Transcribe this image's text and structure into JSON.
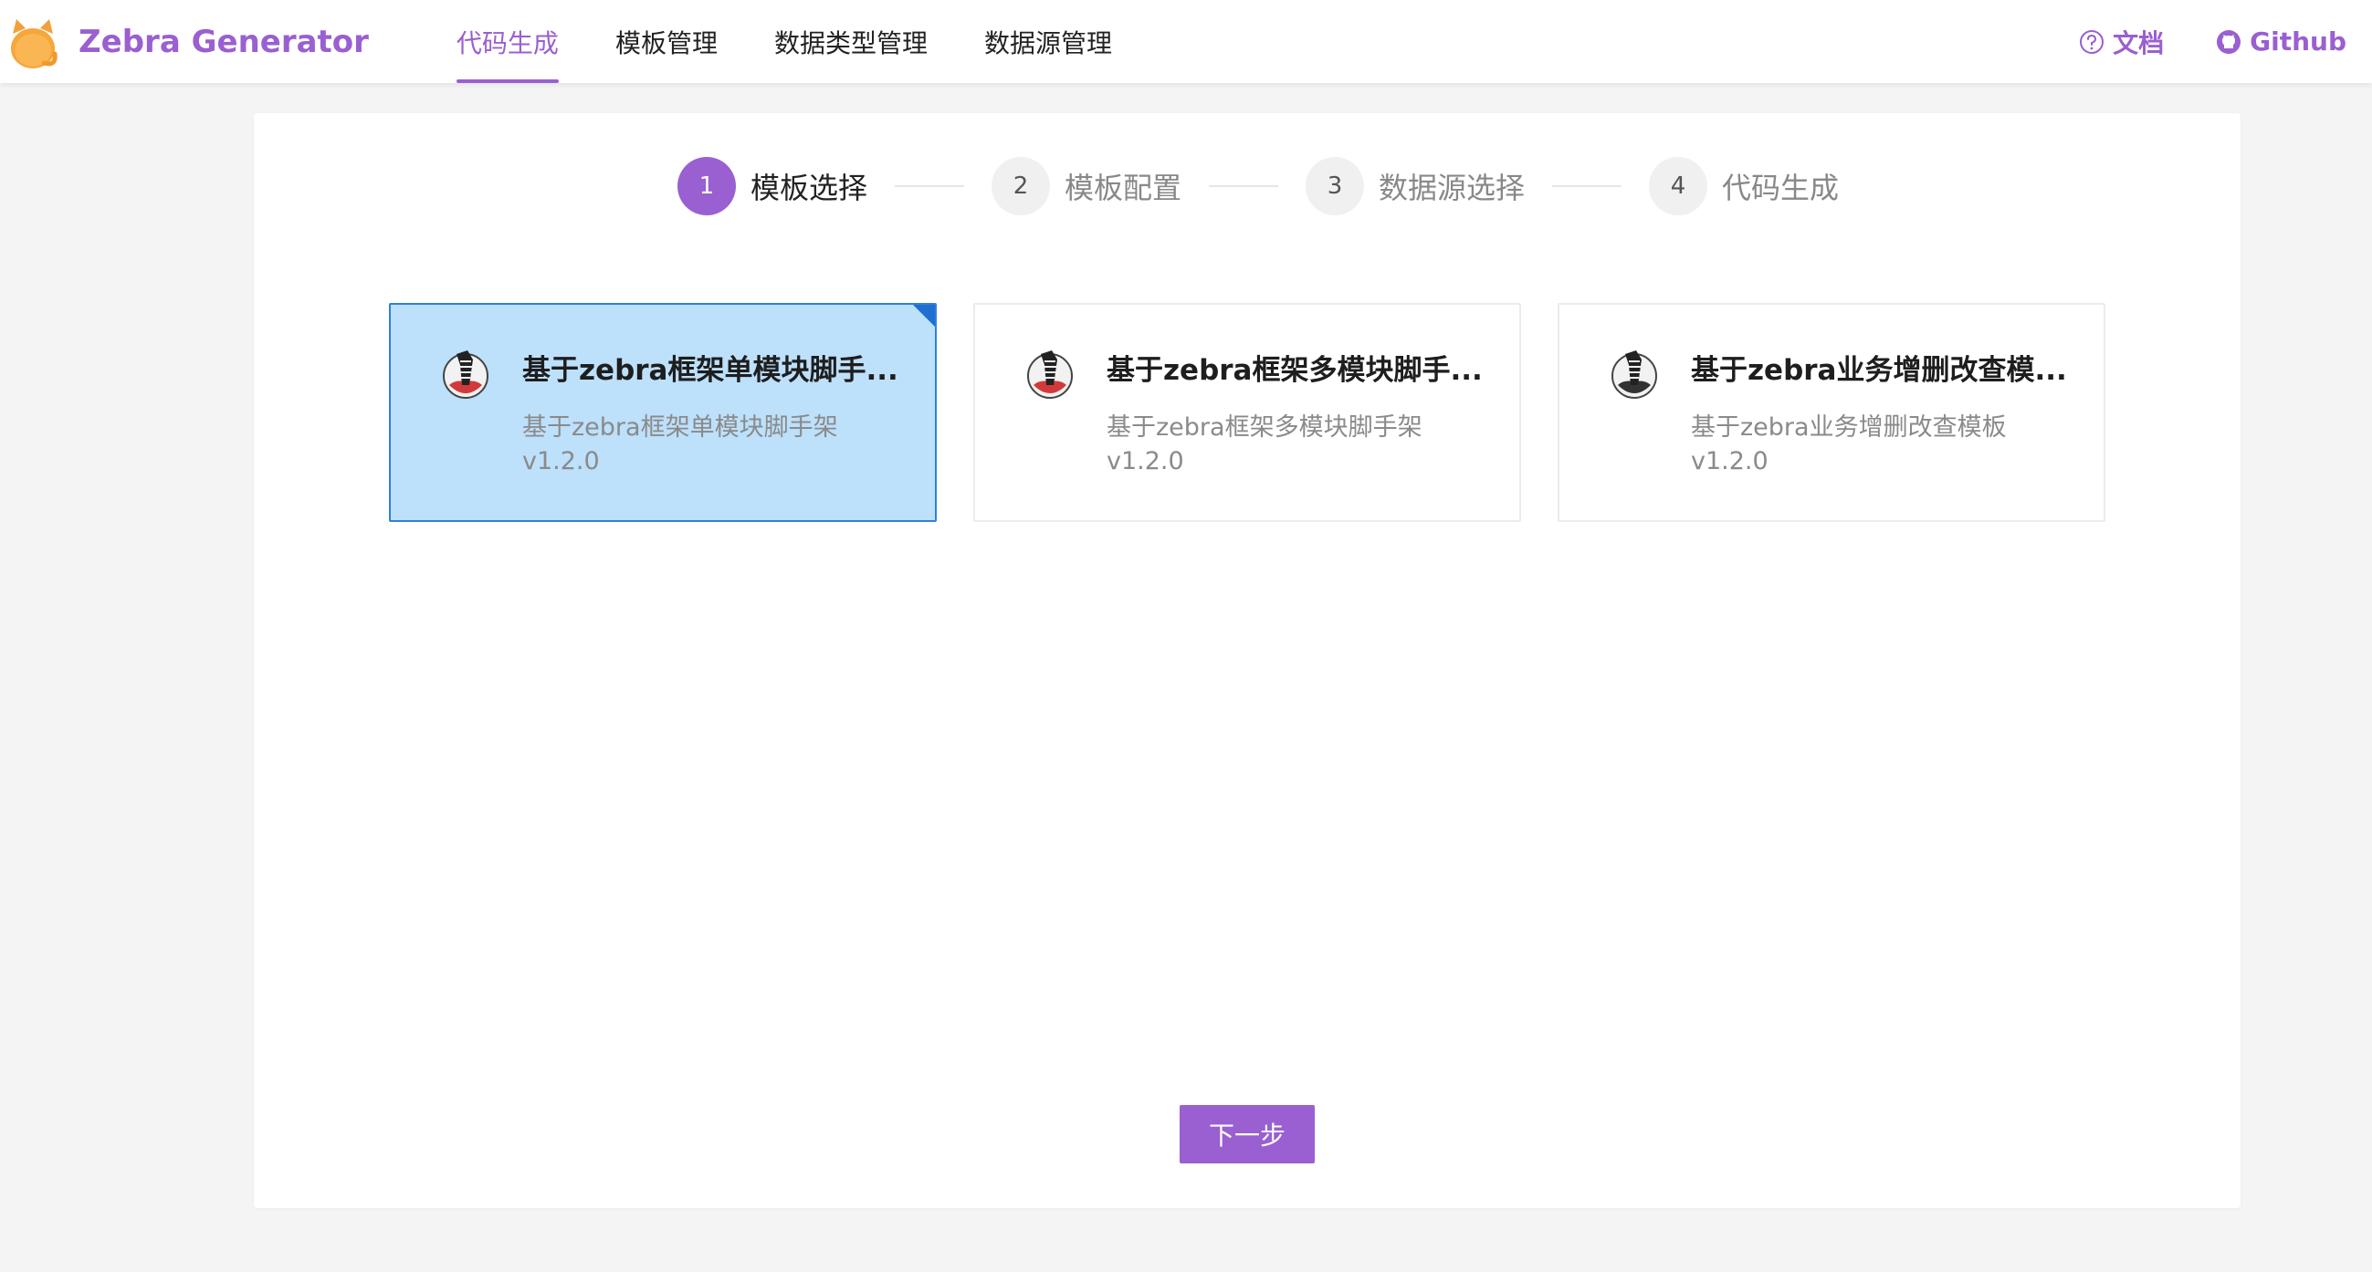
{
  "header": {
    "brand": "Zebra Generator",
    "nav": [
      {
        "label": "代码生成",
        "active": true
      },
      {
        "label": "模板管理",
        "active": false
      },
      {
        "label": "数据类型管理",
        "active": false
      },
      {
        "label": "数据源管理",
        "active": false
      }
    ],
    "links": {
      "docs": "文档",
      "github": "Github"
    }
  },
  "steps": [
    {
      "number": "1",
      "title": "模板选择",
      "active": true
    },
    {
      "number": "2",
      "title": "模板配置",
      "active": false
    },
    {
      "number": "3",
      "title": "数据源选择",
      "active": false
    },
    {
      "number": "4",
      "title": "代码生成",
      "active": false
    }
  ],
  "templates": [
    {
      "title": "基于zebra框架单模块脚手...",
      "description": "基于zebra框架单模块脚手架",
      "version": "v1.2.0",
      "selected": true
    },
    {
      "title": "基于zebra框架多模块脚手...",
      "description": "基于zebra框架多模块脚手架",
      "version": "v1.2.0",
      "selected": false
    },
    {
      "title": "基于zebra业务增删改查模...",
      "description": "基于zebra业务增删改查模板",
      "version": "v1.2.0",
      "selected": false
    }
  ],
  "next_button": "下一步",
  "colors": {
    "accent": "#9a5fd0",
    "selected_card_bg": "#bde0fb",
    "selected_card_border": "#2f80d8"
  }
}
